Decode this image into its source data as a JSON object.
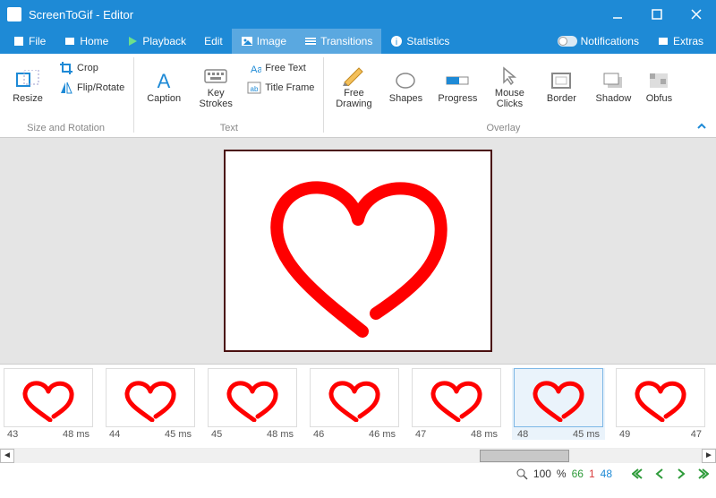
{
  "titlebar": {
    "title": "ScreenToGif - Editor"
  },
  "menu": {
    "file": "File",
    "home": "Home",
    "playback": "Playback",
    "edit": "Edit",
    "image": "Image",
    "transitions": "Transitions",
    "statistics": "Statistics",
    "notifications": "Notifications",
    "extras": "Extras"
  },
  "ribbon": {
    "resize": "Resize",
    "crop": "Crop",
    "fliprotate": "Flip/Rotate",
    "caption": "Caption",
    "keystrokes": "Key Strokes",
    "freetext": "Free Text",
    "titleframe": "Title Frame",
    "freedrawing": "Free Drawing",
    "shapes": "Shapes",
    "progress": "Progress",
    "mouseclicks": "Mouse Clicks",
    "border": "Border",
    "shadow": "Shadow",
    "obfuscate": "Obfus",
    "group_size": "Size and Rotation",
    "group_text": "Text",
    "group_overlay": "Overlay"
  },
  "frames": [
    {
      "num": "43",
      "dur": "48 ms",
      "selected": false
    },
    {
      "num": "44",
      "dur": "45 ms",
      "selected": false
    },
    {
      "num": "45",
      "dur": "48 ms",
      "selected": false
    },
    {
      "num": "46",
      "dur": "46 ms",
      "selected": false
    },
    {
      "num": "47",
      "dur": "48 ms",
      "selected": false
    },
    {
      "num": "48",
      "dur": "45 ms",
      "selected": true
    },
    {
      "num": "49",
      "dur": "47",
      "selected": false
    }
  ],
  "status": {
    "zoom": "100",
    "pct": "%",
    "total": "66",
    "sel": "1",
    "cur": "48"
  }
}
